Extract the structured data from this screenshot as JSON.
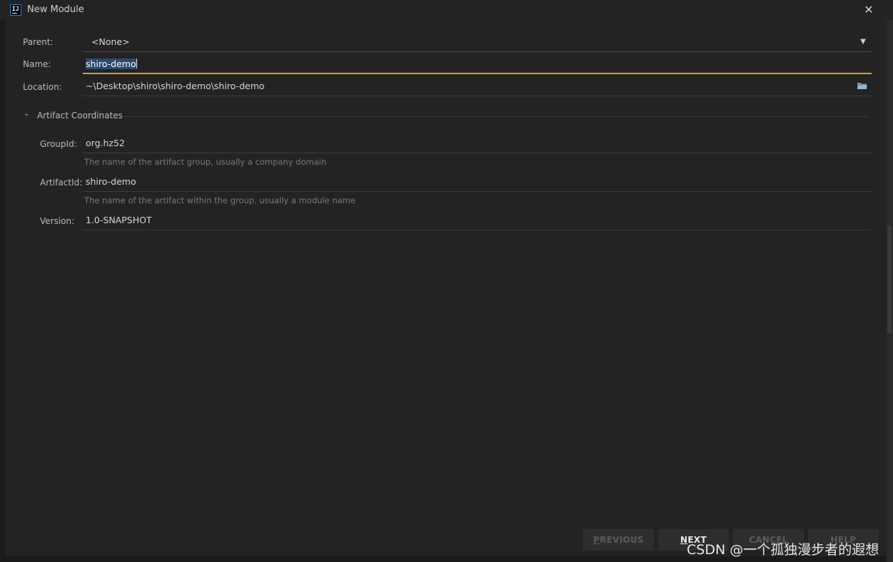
{
  "window": {
    "title": "New Module",
    "icon_text": "IJ"
  },
  "form": {
    "parent": {
      "label": "Parent:",
      "value": "<None>"
    },
    "name": {
      "label": "Name:",
      "value": "shiro-demo"
    },
    "location": {
      "label": "Location:",
      "value": "~\\Desktop\\shiro\\shiro-demo\\shiro-demo"
    }
  },
  "artifact": {
    "section_title": "Artifact Coordinates",
    "group_id": {
      "label": "GroupId:",
      "value": "org.hz52",
      "hint": "The name of the artifact group, usually a company domain"
    },
    "artifact_id": {
      "label": "ArtifactId:",
      "value": "shiro-demo",
      "hint": "The name of the artifact within the group, usually a module name"
    },
    "version": {
      "label": "Version:",
      "value": "1.0-SNAPSHOT"
    }
  },
  "buttons": {
    "previous": {
      "mnemonic": "P",
      "rest": "REVIOUS"
    },
    "next": {
      "mnemonic": "N",
      "rest": "EXT"
    },
    "cancel": {
      "label": "CANCEL"
    },
    "help": {
      "label": "HELP"
    }
  },
  "watermark": "CSDN @一个孤独漫步者的遐想",
  "colors": {
    "background": "#232323",
    "focus_underline": "#e59b2a",
    "selection": "#2b4a6e"
  },
  "icons": [
    "ij-app-icon",
    "close-icon",
    "dropdown-arrow-icon",
    "folder-icon",
    "chevron-down-icon"
  ]
}
